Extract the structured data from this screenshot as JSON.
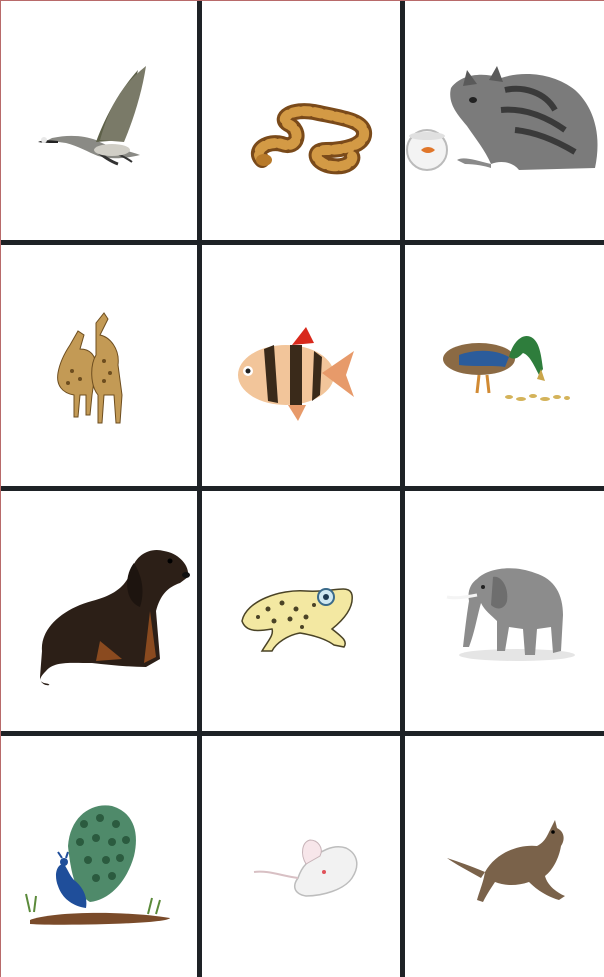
{
  "grid": {
    "cells": [
      {
        "animal": "canada-goose",
        "icon": "goose-icon"
      },
      {
        "animal": "snake",
        "icon": "snake-icon"
      },
      {
        "animal": "cat-with-fishbowl",
        "icon": "cat-icon"
      },
      {
        "animal": "giraffes",
        "icon": "giraffe-icon"
      },
      {
        "animal": "tiger-barb-fish",
        "icon": "fish-icon"
      },
      {
        "animal": "mallard-duck",
        "icon": "duck-icon"
      },
      {
        "animal": "dachshund",
        "icon": "dog-icon"
      },
      {
        "animal": "frog",
        "icon": "frog-icon"
      },
      {
        "animal": "elephant",
        "icon": "elephant-icon"
      },
      {
        "animal": "peacock",
        "icon": "peacock-icon"
      },
      {
        "animal": "mouse",
        "icon": "mouse-icon"
      },
      {
        "animal": "kangaroo",
        "icon": "kangaroo-icon"
      }
    ],
    "colors": {
      "background": "#ffffff",
      "gridlines": "#1e2226",
      "edge": "#b86a6a"
    }
  }
}
